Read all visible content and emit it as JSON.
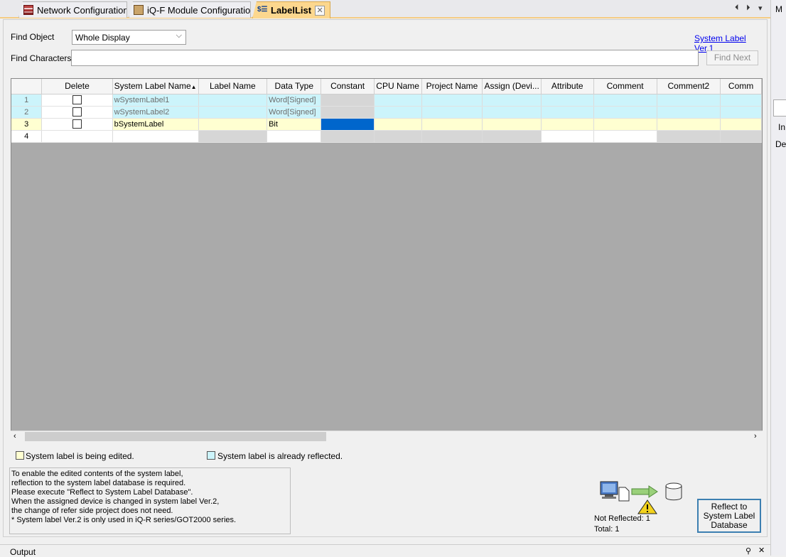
{
  "tabs": [
    {
      "label": "Network Configuration",
      "icon": "network-config-icon",
      "active": false
    },
    {
      "label": "iQ-F Module Configuration",
      "icon": "module-config-icon",
      "active": false
    },
    {
      "label": "LabelList",
      "icon": "label-list-icon",
      "active": true
    }
  ],
  "tab_nav": {
    "left": "⏴",
    "right": "⏵",
    "menu": "▾"
  },
  "find": {
    "object_label": "Find Object",
    "object_value": "Whole Display",
    "characters_label": "Find Characters",
    "characters_value": "",
    "find_next": "Find Next",
    "version_link": "System Label Ver.1"
  },
  "grid": {
    "columns": [
      "Delete",
      "System Label Name",
      "Label Name",
      "Data Type",
      "Constant",
      "CPU Name",
      "Project Name",
      "Assign (Devi...",
      "Attribute",
      "Comment",
      "Comment2",
      "Comm"
    ],
    "rows": [
      {
        "num": "1",
        "name": "wSystemLabel1",
        "label": "",
        "type": "Word[Signed]"
      },
      {
        "num": "2",
        "name": "wSystemLabel2",
        "label": "",
        "type": "Word[Signed]"
      },
      {
        "num": "3",
        "name": "bSystemLabel",
        "label": "",
        "type": "Bit"
      },
      {
        "num": "4",
        "name": "",
        "label": "",
        "type": ""
      }
    ]
  },
  "legend": {
    "editing": "System label is being edited.",
    "reflected": "System label is already reflected.",
    "editing_color": "#ffffd1",
    "reflected_color": "#ccf4fb"
  },
  "info_lines": [
    "To enable the edited contents of the system label,",
    "reflection to the system label database is required.",
    "Please execute \"Reflect to System Label Database\".",
    "When the assigned device is changed in system label Ver.2,",
    "the change of refer side project does not need.",
    "* System label Ver.2 is only used in iQ-R series/GOT2000 series."
  ],
  "status": {
    "not_reflected": "Not Reflected: 1",
    "total": "Total: 1"
  },
  "reflect_button": "Reflect to System Label Database",
  "side": {
    "m": "M",
    "i": "In",
    "de": "De"
  },
  "bottom": {
    "title": "Output"
  }
}
